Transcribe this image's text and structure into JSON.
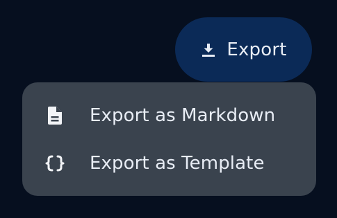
{
  "export_button": {
    "label": "Export",
    "icon": "download-icon"
  },
  "menu": {
    "items": [
      {
        "label": "Export as Markdown",
        "icon": "document-icon"
      },
      {
        "label": "Export as Template",
        "icon": "braces-icon"
      }
    ]
  },
  "colors": {
    "background": "#060f1f",
    "button_bg": "#0b2a57",
    "menu_bg": "#3a434e",
    "text": "#e8edf5"
  }
}
